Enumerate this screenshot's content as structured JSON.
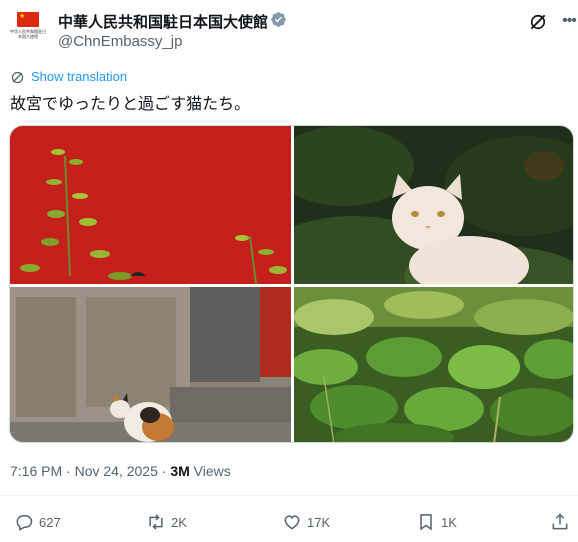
{
  "author": {
    "display_name": "中華人民共和国駐日本国大使館",
    "handle": "@ChnEmbassy_jp",
    "avatar_caption": "中华人民共和国驻日本国大使馆",
    "verified_badge_color": "#829aab"
  },
  "translate": {
    "label": "Show translation",
    "icon": "globe-icon"
  },
  "tweet": {
    "text": "故宮でゆったりと過ごす猫たち。"
  },
  "media": [
    {
      "name": "red-wall-plants-photo"
    },
    {
      "name": "white-cat-photo"
    },
    {
      "name": "calico-cat-stone-wall-photo"
    },
    {
      "name": "green-leaves-photo"
    }
  ],
  "meta": {
    "time": "7:16 PM",
    "separator": " · ",
    "date": "Nov 24, 2025",
    "views_count": "3M",
    "views_label": " Views"
  },
  "actions": {
    "replies": "627",
    "reposts": "2K",
    "likes": "17K",
    "bookmarks": "1K"
  },
  "colors": {
    "accent": "#1d9bf0",
    "text": "#0f1419",
    "muted": "#536471"
  }
}
